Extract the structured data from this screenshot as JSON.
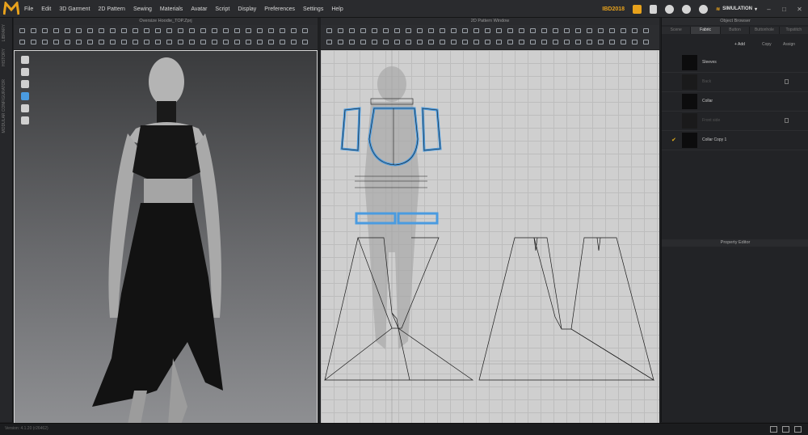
{
  "menu": {
    "items": [
      "File",
      "Edit",
      "3D Garment",
      "2D Pattern",
      "Sewing",
      "Materials",
      "Avatar",
      "Script",
      "Display",
      "Preferences",
      "Settings",
      "Help"
    ],
    "user_badge": "IBD2018",
    "mode_label": "SIMULATION"
  },
  "left_tabs": [
    "LIBRARY",
    "HISTORY",
    "MODULAR CONFIGURATOR"
  ],
  "panels": {
    "view3d_title": "Oversize Hoodie_TOP.Zprj",
    "view2d_title": "2D Pattern Window",
    "object_browser_title": "Object Browser",
    "property_editor_title": "Property Editor"
  },
  "object_browser": {
    "tabs": [
      "Scene",
      "Fabric",
      "Button",
      "Buttonhole",
      "Topstitch"
    ],
    "active_tab": "Fabric",
    "add_label": "+ Add",
    "copy_label": "Copy",
    "assign_label": "Assign",
    "items": [
      {
        "name": "Sleeves",
        "dim": false,
        "checked": false,
        "trash": false
      },
      {
        "name": "Back",
        "dim": true,
        "checked": false,
        "trash": true
      },
      {
        "name": "Collar",
        "dim": false,
        "checked": false,
        "trash": false
      },
      {
        "name": "Front side",
        "dim": true,
        "checked": false,
        "trash": true
      },
      {
        "name": "Collar Copy 1",
        "dim": false,
        "checked": true,
        "trash": false
      }
    ]
  },
  "status": {
    "text": "Version: 4.1.20 (r26462)"
  },
  "colors": {
    "accent": "#e8a21c",
    "selection": "#4a9be0"
  }
}
